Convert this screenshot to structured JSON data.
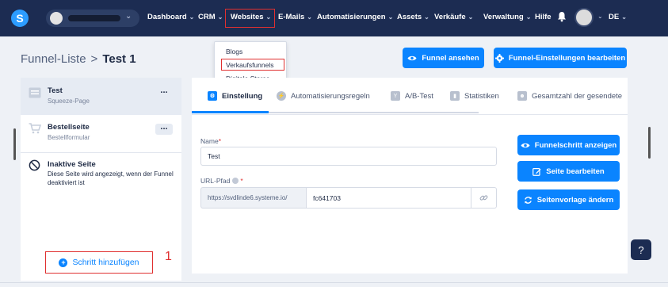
{
  "navbar": {
    "logo": "S",
    "items": [
      {
        "label": "Dashboard",
        "has_chevron": true
      },
      {
        "label": "CRM",
        "has_chevron": true
      },
      {
        "label": "Websites",
        "has_chevron": true
      },
      {
        "label": "E-Mails",
        "has_chevron": true
      },
      {
        "label": "Automatisierungen",
        "has_chevron": true
      },
      {
        "label": "Assets",
        "has_chevron": true
      },
      {
        "label": "Verkäufe",
        "has_chevron": true
      },
      {
        "label": "Verwaltung",
        "has_chevron": true
      },
      {
        "label": "Hilfe",
        "has_chevron": false
      }
    ],
    "language": "DE",
    "chevron": "⌄"
  },
  "websites_dropdown": {
    "items": [
      "Blogs",
      "Verkaufsfunnels",
      "Digitale Stores"
    ]
  },
  "breadcrumb": {
    "parent": "Funnel-Liste",
    "separator": ">",
    "current": "Test 1"
  },
  "header_buttons": {
    "view_funnel": "Funnel ansehen",
    "edit_settings": "Funnel-Einstellungen bearbeiten"
  },
  "steps": [
    {
      "title": "Test",
      "subtitle": "Squeeze-Page",
      "menu": "..."
    },
    {
      "title": "Bestellseite",
      "subtitle": "Bestellformular",
      "menu": "..."
    }
  ],
  "inactive_page": {
    "title": "Inaktive Seite",
    "description": "Diese Seite wird angezeigt, wenn der Funnel deaktiviert ist"
  },
  "add_step_label": "Schritt hinzufügen",
  "annotation_number": "1",
  "tabs": [
    {
      "label": "Einstellung",
      "active": true
    },
    {
      "label": "Automatisierungsregeln",
      "active": false
    },
    {
      "label": "A/B-Test",
      "active": false
    },
    {
      "label": "Statistiken",
      "active": false
    },
    {
      "label": "Gesamtzahl der gesendete",
      "active": false
    }
  ],
  "form": {
    "name_label": "Name",
    "required_mark": "*",
    "name_value": "Test",
    "url_label": "URL-Pfad",
    "url_prefix": "https://svdlinde6.systeme.io/",
    "url_value": "fc641703"
  },
  "side_actions": {
    "show_step": "Funnelschritt anzeigen",
    "edit_page": "Seite bearbeiten",
    "change_template": "Seitenvorlage ändern"
  },
  "help_button": "?",
  "colors": {
    "navbar": "#1c2c52",
    "accent": "#0a84ff",
    "annotation": "#e03030",
    "page_bg": "#eef1f6"
  }
}
